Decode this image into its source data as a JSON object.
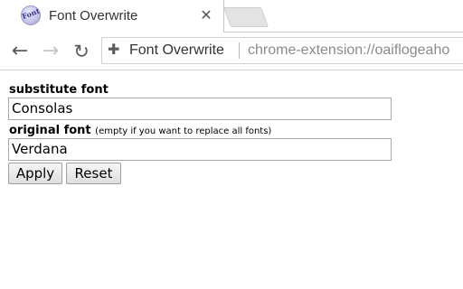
{
  "tab": {
    "favicon_text": "Font",
    "title": "Font Overwrite",
    "close_glyph": "✕",
    "favicon_icon": "font-extension-icon"
  },
  "toolbar": {
    "back_glyph": "←",
    "forward_glyph": "→",
    "reload_glyph": "↻",
    "omnibox_icon": "puzzle-icon",
    "omnibox_icon_glyph": "✚",
    "extension_name": "Font Overwrite",
    "url": "chrome-extension://oaiflogeaho"
  },
  "form": {
    "substitute_label": "substitute font",
    "substitute_value": "Consolas",
    "original_label": "original font",
    "original_hint": "(empty if you want to replace all fonts)",
    "original_value": "Verdana",
    "apply_label": "Apply",
    "reset_label": "Reset"
  }
}
